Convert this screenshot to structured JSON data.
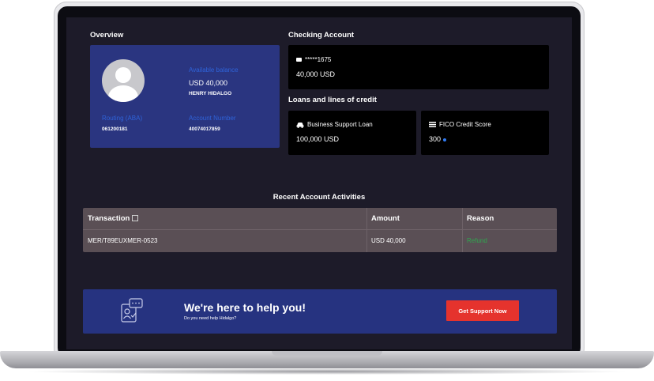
{
  "overview": {
    "title": "Overview",
    "available_balance_label": "Available balance",
    "available_balance_value": "USD 40,000",
    "account_holder": "HENRY HIDALGO",
    "routing_label": "Routing (ABA)",
    "routing_value": "061200181",
    "account_number_label": "Account Number",
    "account_number_value": "40074017859"
  },
  "checking": {
    "title": "Checking Account",
    "masked_number": "*****1675",
    "balance": "40,000 USD"
  },
  "loans": {
    "title": "Loans and lines of credit",
    "loan_name": "Business Support Loan",
    "loan_amount": "100,000 USD",
    "fico_label": "FICO Credit Score",
    "fico_value": "300"
  },
  "activities": {
    "title": "Recent Account Activities",
    "columns": [
      "Transaction",
      "Amount",
      "Reason"
    ],
    "rows": [
      {
        "transaction": "MER/T89EUXMER-0523",
        "amount": "USD 40,000",
        "reason": "Refund"
      }
    ]
  },
  "help": {
    "headline": "We're here to help you!",
    "subtext": "Do you need help Hidalgo?",
    "button_label": "Get Support Now"
  },
  "colors": {
    "screen_bg": "#1d1b29",
    "overview_card": "#2a3580",
    "label_blue": "#2f63d9",
    "refund_green": "#2fa84f",
    "support_red": "#e5332d"
  }
}
